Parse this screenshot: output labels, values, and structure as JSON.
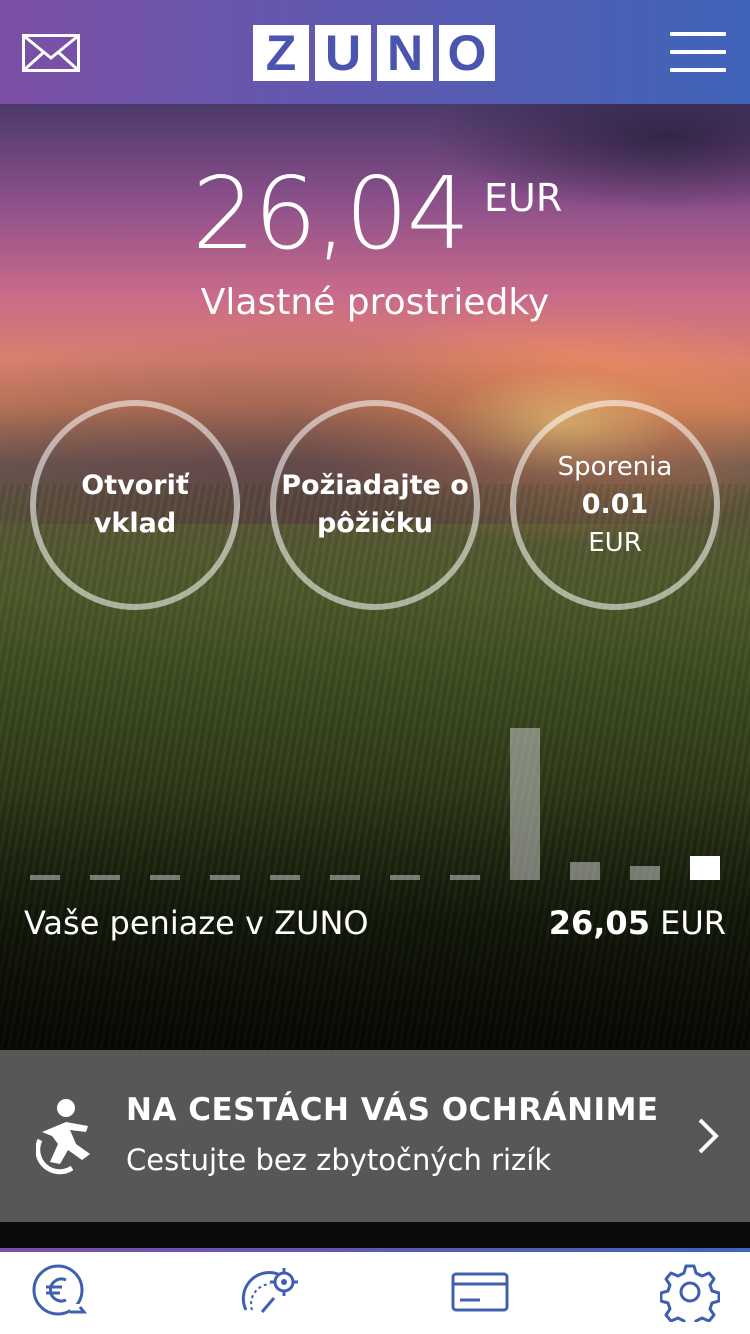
{
  "header": {
    "logo_letters": [
      "Z",
      "U",
      "N",
      "O"
    ],
    "mail_icon": "envelope-icon",
    "menu_icon": "hamburger-menu-icon"
  },
  "balance": {
    "amount": "26,04",
    "currency": "EUR",
    "label": "Vlastné prostriedky"
  },
  "actions": {
    "deposit": {
      "line1": "Otvoriť",
      "line2": "vklad"
    },
    "loan": {
      "line1": "Požiadajte o",
      "line2": "pôžičku"
    },
    "savings": {
      "label": "Sporenia",
      "value": "0.01",
      "currency": "EUR"
    }
  },
  "money_summary": {
    "label": "Vaše peniaze v ZUNO",
    "value": "26,05",
    "currency": "EUR"
  },
  "chart_data": {
    "type": "bar",
    "values": [
      0,
      0,
      0,
      0,
      0,
      0,
      0,
      0,
      26.05,
      0.3,
      0.1,
      26.05
    ],
    "highlighted_index": 11
  },
  "promo": {
    "title": "NA CESTÁCH VÁS OCHRÁNIME",
    "subtitle": "Cestujte bez zbytočných rizík",
    "icon": "traveler-icon",
    "chevron": "chevron-right-icon"
  },
  "tabbar": {
    "tabs": [
      "euro-transfer-icon",
      "gauge-settings-icon",
      "card-icon",
      "settings-gear-icon"
    ]
  },
  "colors": {
    "header_start": "#7c4fa6",
    "header_end": "#3f64b8",
    "accent_blue": "#3f5fb0",
    "promo_bg": "#565856"
  }
}
